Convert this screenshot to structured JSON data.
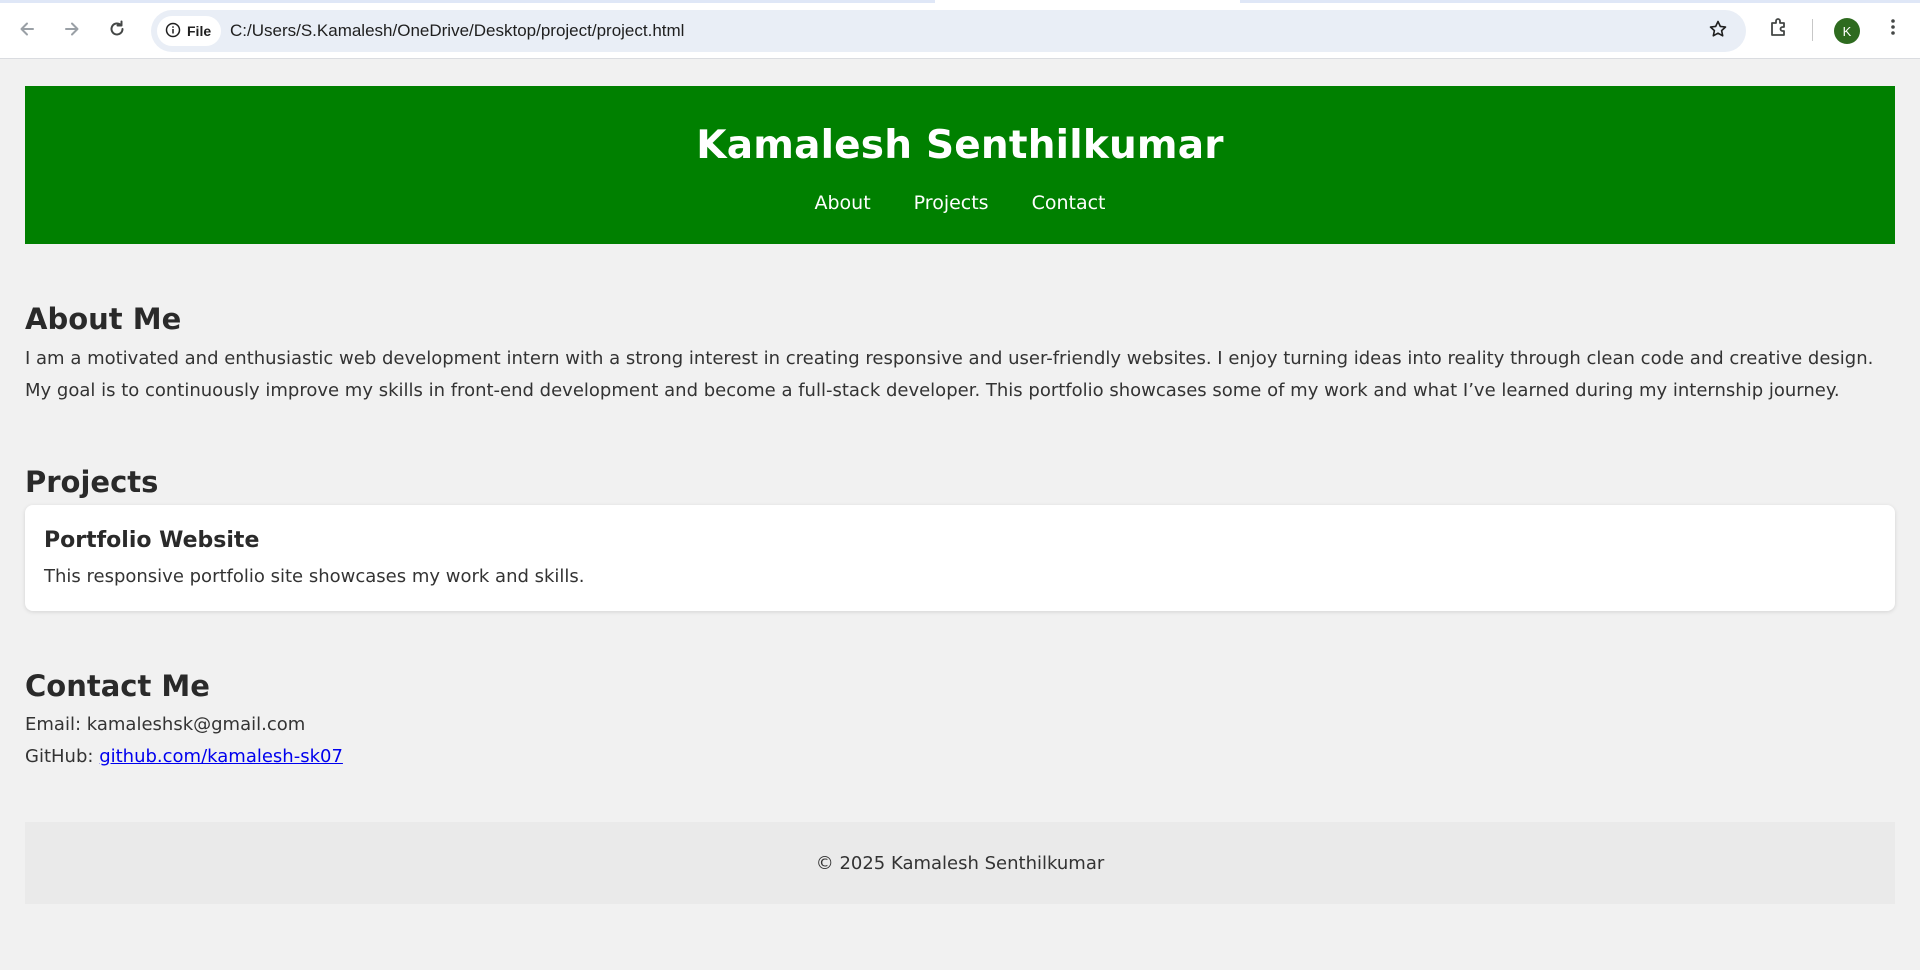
{
  "browser": {
    "chip_label": "File",
    "url": "C:/Users/S.Kamalesh/OneDrive/Desktop/project/project.html",
    "profile_initial": "K",
    "icons": [
      "back-arrow-icon",
      "forward-arrow-icon",
      "reload-icon",
      "info-icon",
      "star-icon",
      "extensions-icon",
      "more-vert-icon"
    ]
  },
  "header": {
    "title": "Kamalesh Senthilkumar",
    "nav": [
      "About",
      "Projects",
      "Contact"
    ],
    "background_color": "#008000"
  },
  "about": {
    "heading": "About Me",
    "text": "I am a motivated and enthusiastic web development intern with a strong interest in creating responsive and user-friendly websites. I enjoy turning ideas into reality through clean code and creative design. My goal is to continuously improve my skills in front-end development and become a full-stack developer. This portfolio showcases some of my work and what I’ve learned during my internship journey."
  },
  "projects": {
    "heading": "Projects",
    "items": [
      {
        "title": "Portfolio Website",
        "description": "This responsive portfolio site showcases my work and skills."
      }
    ]
  },
  "contact": {
    "heading": "Contact Me",
    "email_label": "Email:",
    "email": "kamaleshsk@gmail.com",
    "github_label": "GitHub:",
    "github": "github.com/kamalesh-sk07"
  },
  "footer": {
    "text": "© 2025 Kamalesh Senthilkumar"
  }
}
